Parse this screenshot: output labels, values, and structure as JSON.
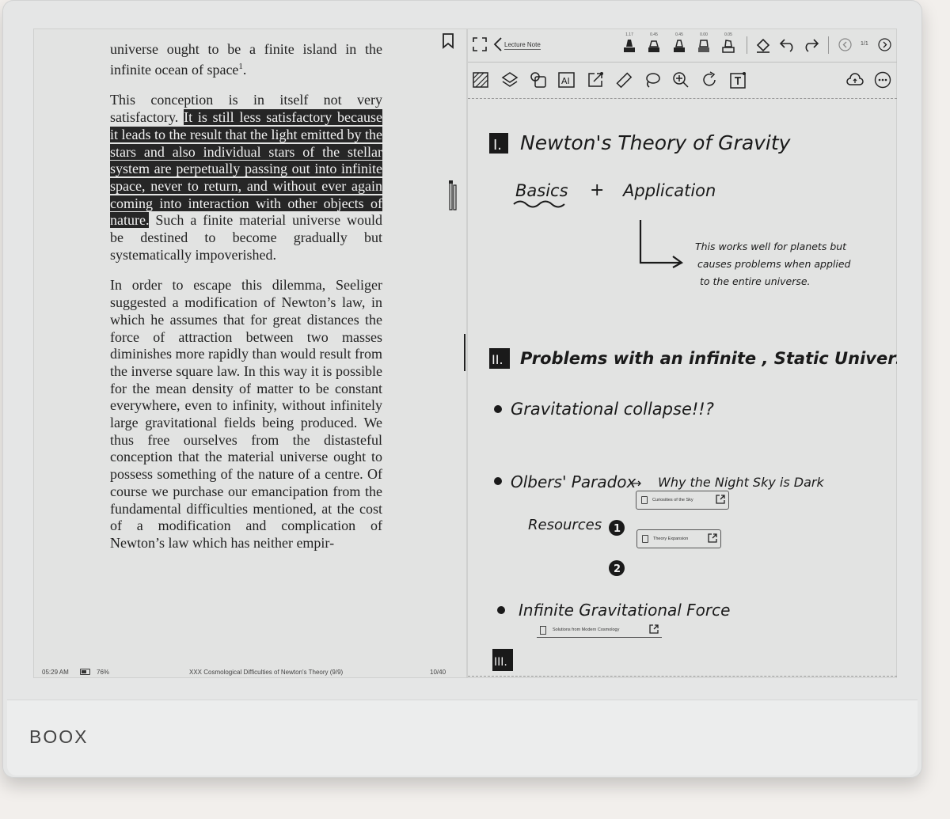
{
  "device": {
    "brand": "BOOX"
  },
  "reader": {
    "paragraphs": [
      {
        "before": "universe ought to be a finite island in the infinite ocean of space",
        "sup": "1",
        "highlight": "",
        "after": "."
      },
      {
        "before": "This conception is in itself not very satisfactory. ",
        "sup": "",
        "highlight": "It is still less satisfactory because it leads to the result that the light emitted by the stars and also individual stars of the stellar system are perpetually passing out into infinite space, never to return, and without ever again coming into interaction with other objects of nature.",
        "after": " Such a finite material universe would be destined to become gradually but systematically impoverished."
      },
      {
        "before": "In order to escape this dilemma, Seeliger suggested a modification of Newton’s law, in which he assumes that for great distances the force of attraction between two masses diminishes more rapidly than would result from the inverse square law. In this way it is possible for the mean density of matter to be constant everywhere, even to infinity, without infinitely large gravitational fields being produced. We thus free ourselves from the distasteful conception that the material universe ought to possess something of the nature of a centre. Of course we purchase our emancipation from the fundamental difficulties mentioned, at the cost of a modification and complication of Newton’s law which has neither empir-",
        "sup": "",
        "highlight": "",
        "after": ""
      }
    ],
    "status": {
      "time": "05:29 AM",
      "battery": "76%",
      "chapter": "XXX Cosmological Difficulties of Newton's Theory (9/9)",
      "page": "10/40"
    }
  },
  "note": {
    "toolbar": {
      "back_label": "Lecture Note",
      "pen_widths": [
        "1.17",
        "0.45",
        "0.45",
        "0.00",
        "0.05"
      ],
      "page_indicator": "1/1"
    },
    "handwriting": {
      "h1_num": "I.",
      "h1_text": "Newton's Theory of Gravity",
      "basics": "Basics",
      "plus": "+",
      "application": "Application",
      "note_l1": "This works well for planets but",
      "note_l2": "causes problems when applied",
      "note_l3": "to the entire universe.",
      "h2_num": "II.",
      "h2_text": "Problems with an infinite , Static Universe",
      "b1": "Gravitational  collapse!!?",
      "b2a": "Olbers' Paradox",
      "b2arrow": "→",
      "b2b": "Why the Night Sky is Dark",
      "resources": "Resources",
      "r1": "1",
      "r2": "2",
      "b3": "Infinite  Gravitational Force",
      "h3_num": "III."
    },
    "links": [
      {
        "label": "Curiosities of the Sky"
      },
      {
        "label": "Theory Expansion"
      },
      {
        "label": "Solutions from Modern Cosmology"
      }
    ]
  }
}
